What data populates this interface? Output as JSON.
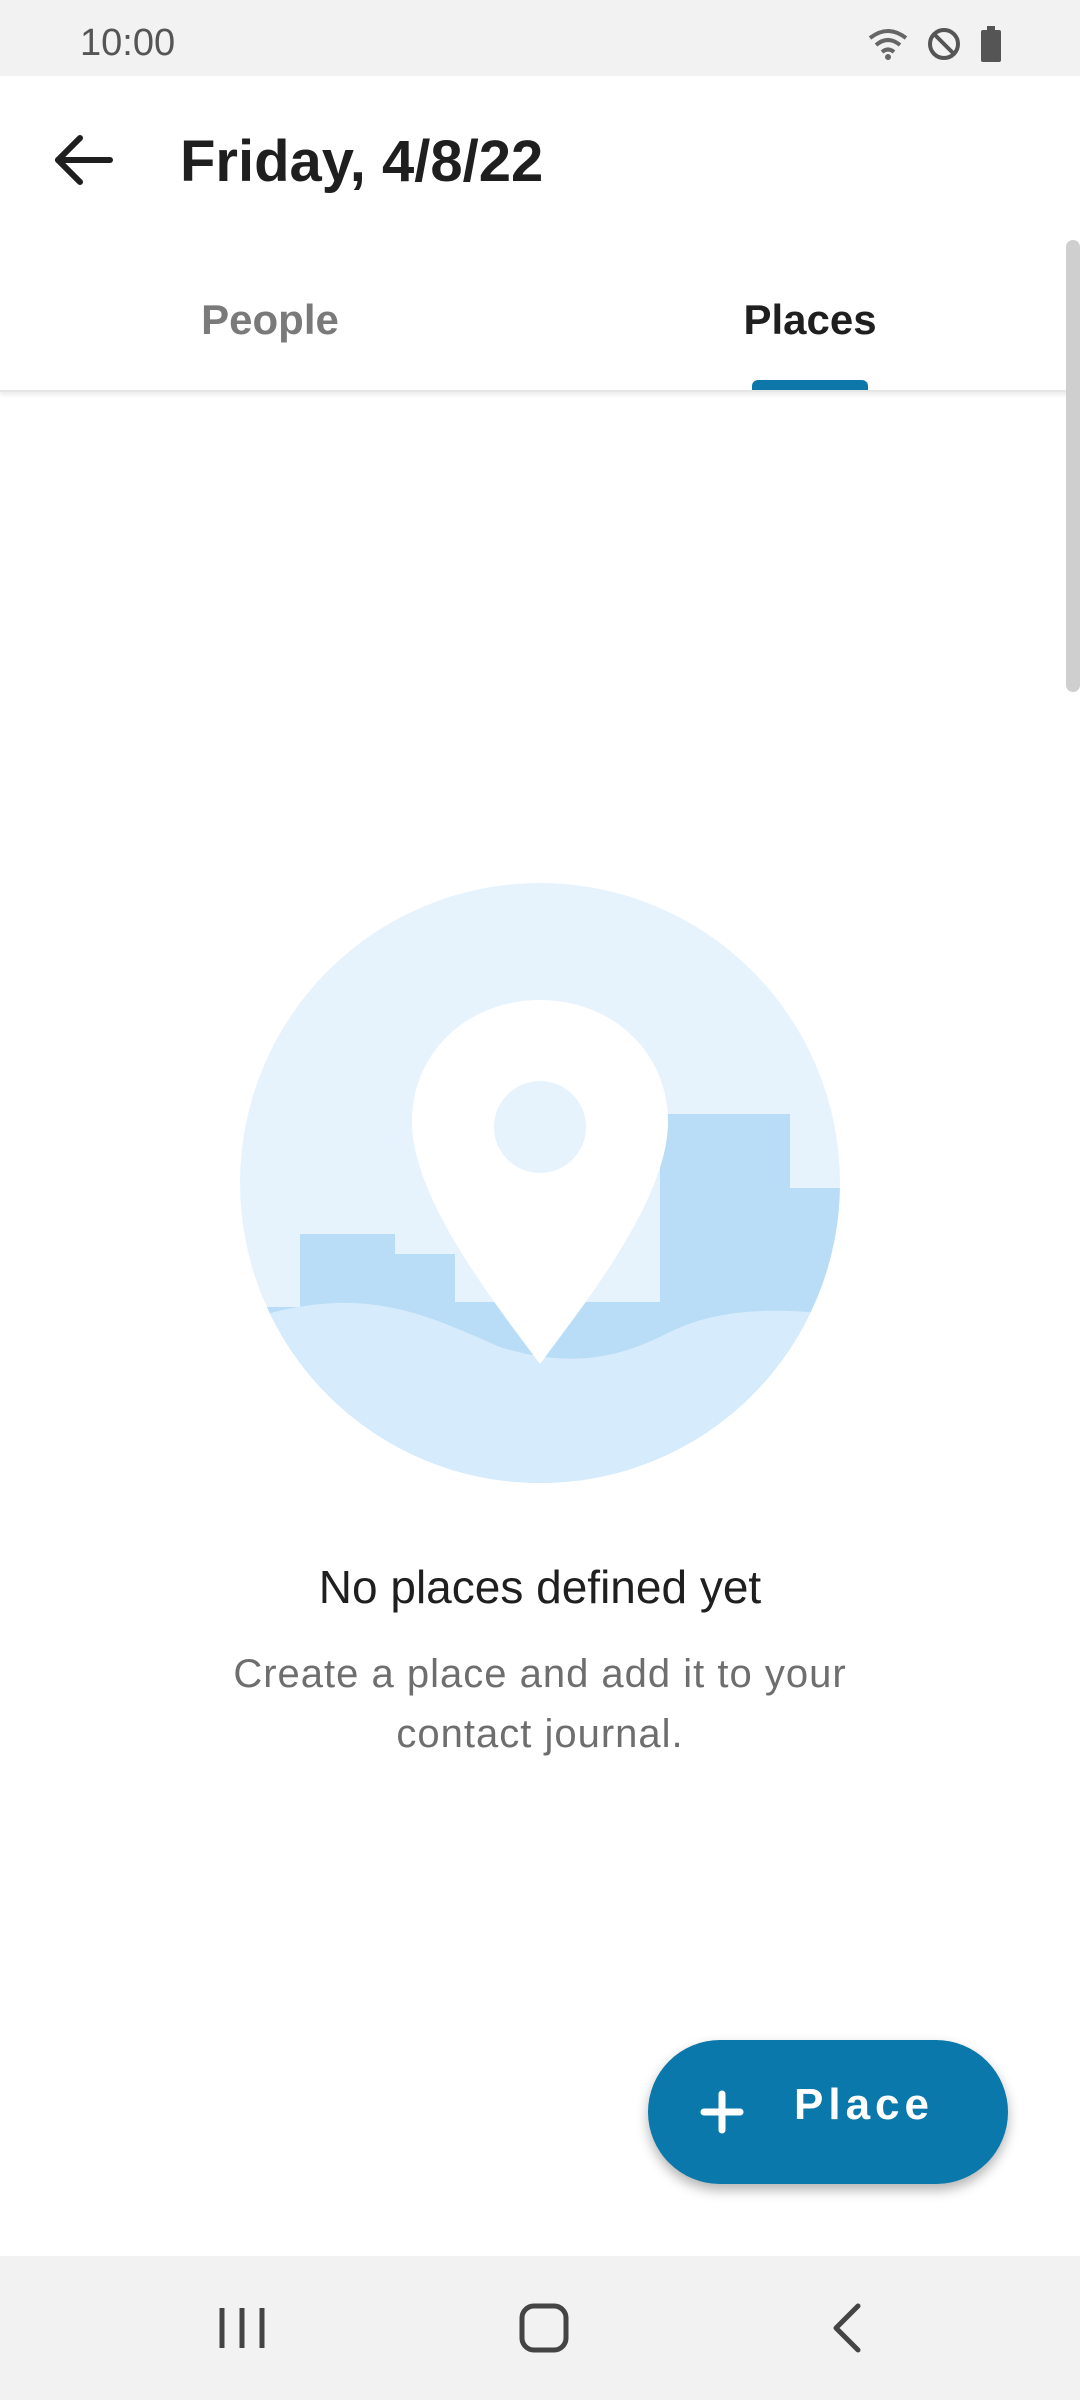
{
  "status_bar": {
    "time": "10:00",
    "icons": [
      "wifi-icon",
      "do-not-disturb-icon",
      "battery-icon"
    ]
  },
  "app_bar": {
    "title": "Friday, 4/8/22",
    "back_icon": "arrow-back-icon"
  },
  "tabs": [
    {
      "label": "People",
      "selected": false
    },
    {
      "label": "Places",
      "selected": true
    }
  ],
  "empty_state": {
    "illustration": "map-pin-landscape-illustration",
    "title": "No places defined yet",
    "description": "Create a place and add it to your contact journal."
  },
  "fab": {
    "icon": "plus-icon",
    "label": "Place"
  },
  "nav_bar": {
    "icons": [
      "recents-icon",
      "home-icon",
      "back-icon"
    ]
  },
  "colors": {
    "accent": "#0a78ab",
    "illustration_light": "#e6f3fd",
    "illustration_mid": "#b9ddf6"
  }
}
